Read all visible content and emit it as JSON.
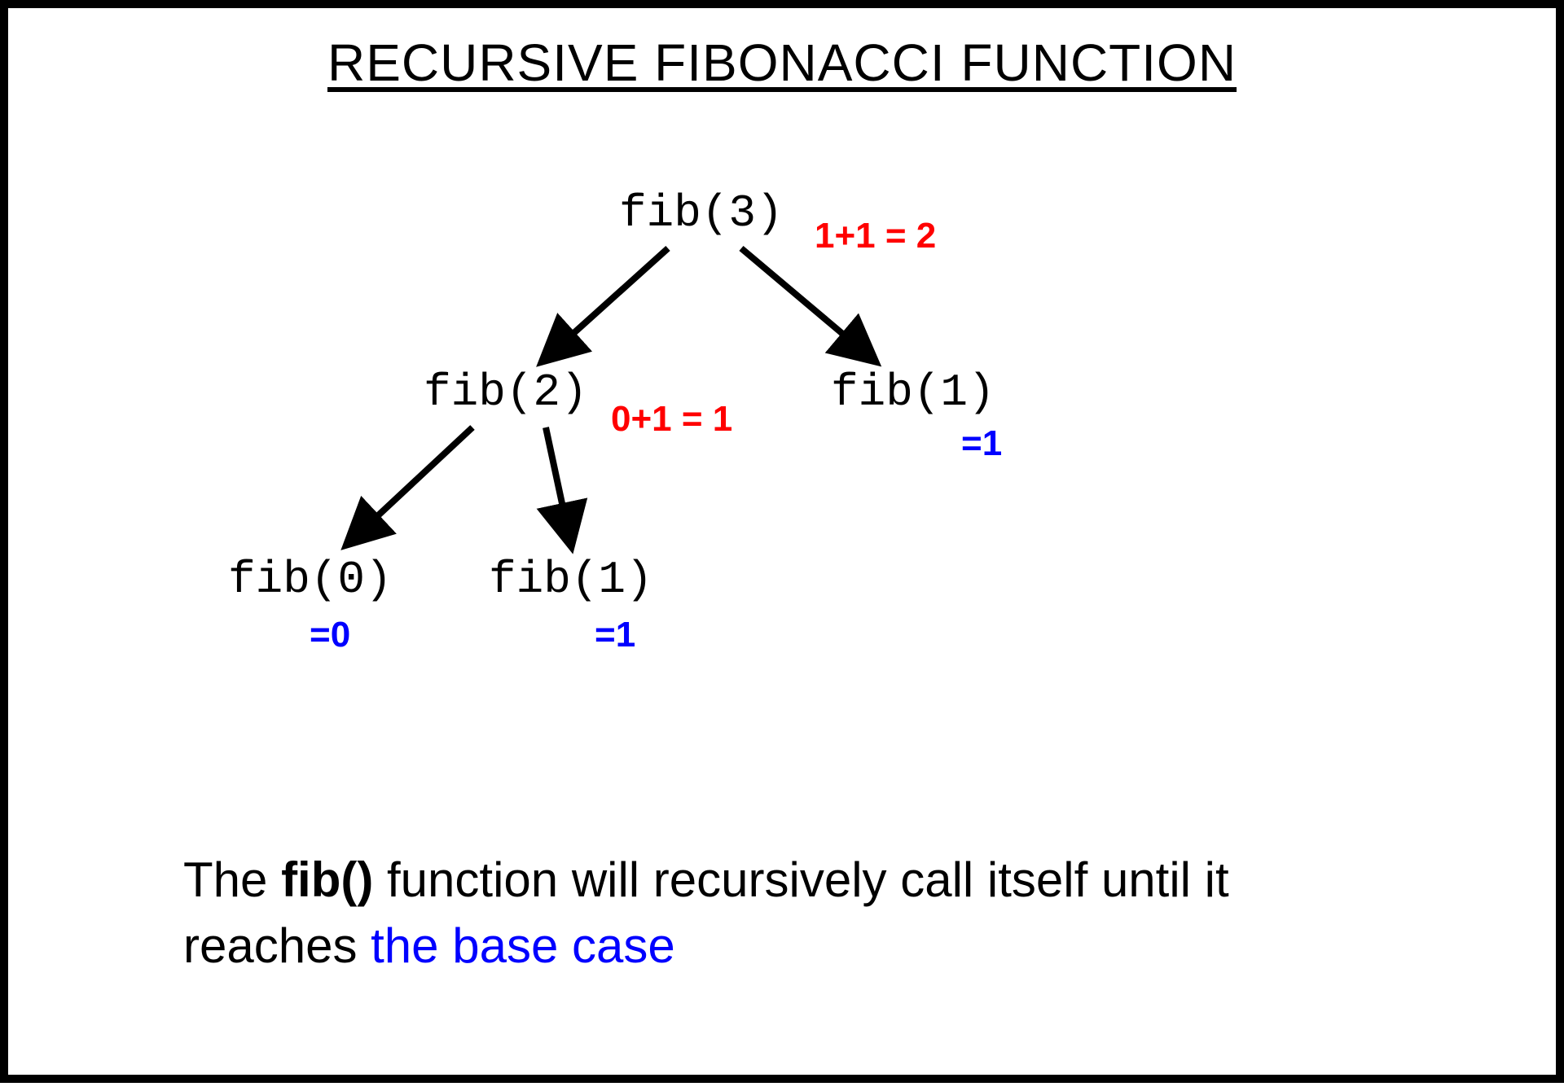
{
  "title": "RECURSIVE FIBONACCI FUNCTION",
  "nodes": {
    "fib3": "fib(3)",
    "fib2": "fib(2)",
    "fib1_right": "fib(1)",
    "fib0": "fib(0)",
    "fib1_left": "fib(1)"
  },
  "annotations": {
    "sum3": "1+1 = 2",
    "sum2": "0+1 = 1",
    "eq1_right": "=1",
    "eq0": "=0",
    "eq1_left": "=1"
  },
  "caption": {
    "part1": "The ",
    "bold": "fib()",
    "part2": " function will recursively call itself until it reaches ",
    "blue": "the base case"
  }
}
